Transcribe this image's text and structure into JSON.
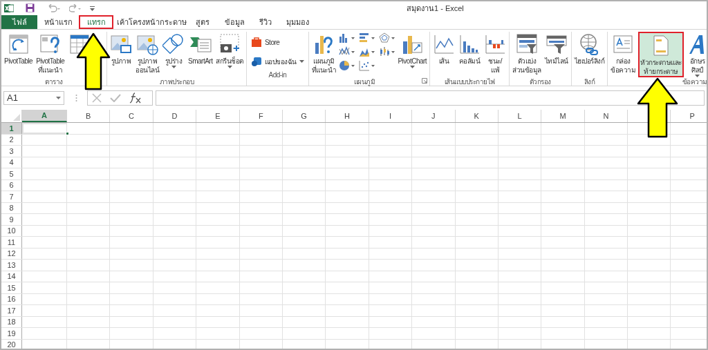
{
  "window": {
    "title": "สมุดงาน1 - Excel"
  },
  "tabs": [
    {
      "label": "ไฟล์",
      "kind": "file",
      "selected": false,
      "highlighted": false
    },
    {
      "label": "หน้าแรก",
      "kind": "tab",
      "selected": false,
      "highlighted": false
    },
    {
      "label": "แทรก",
      "kind": "tab",
      "selected": true,
      "highlighted": true
    },
    {
      "label": "เค้าโครงหน้ากระดาษ",
      "kind": "tab",
      "selected": false,
      "highlighted": false
    },
    {
      "label": "สูตร",
      "kind": "tab",
      "selected": false,
      "highlighted": false
    },
    {
      "label": "ข้อมูล",
      "kind": "tab",
      "selected": false,
      "highlighted": false
    },
    {
      "label": "รีวิว",
      "kind": "tab",
      "selected": false,
      "highlighted": false
    },
    {
      "label": "มุมมอง",
      "kind": "tab",
      "selected": false,
      "highlighted": false
    }
  ],
  "ribbon": {
    "groups": [
      {
        "label": "ตาราง",
        "items": [
          {
            "kind": "large",
            "lines": [
              "PivotTable"
            ]
          },
          {
            "kind": "large",
            "lines": [
              "PivotTable",
              "ที่แนะนำ"
            ]
          },
          {
            "kind": "large"
          }
        ]
      },
      {
        "label": "ภาพประกอบ",
        "items": [
          {
            "kind": "large",
            "lines": [
              "รูปภาพ"
            ]
          },
          {
            "kind": "large",
            "lines": [
              "รูปภาพ",
              "ออนไลน์"
            ]
          },
          {
            "kind": "large",
            "lines": [
              "รูปร่าง"
            ],
            "dropdown": true
          },
          {
            "kind": "large",
            "lines": [
              "SmartArt"
            ]
          },
          {
            "kind": "large",
            "lines": [
              "สกรีนช็อต"
            ],
            "dropdown": true
          }
        ]
      },
      {
        "label": "Add-in",
        "items": [
          {
            "kind": "small",
            "lines": [
              "Store"
            ]
          },
          {
            "kind": "small",
            "lines": [
              "แอปของฉัน"
            ],
            "dropdown": true
          }
        ]
      },
      {
        "label": "แผนภูมิ",
        "launcher": true,
        "items": [
          {
            "kind": "large",
            "lines": [
              "แผนภูมิ",
              "ที่แนะนำ"
            ]
          },
          {
            "kind": "chart-grid"
          },
          {
            "kind": "large",
            "lines": [
              "PivotChart"
            ],
            "dropdown": true
          }
        ]
      },
      {
        "label": "เส้นแบบประกายไฟ",
        "items": [
          {
            "kind": "large",
            "lines": [
              "เส้น"
            ]
          },
          {
            "kind": "large",
            "lines": [
              "คอลัมน์"
            ]
          },
          {
            "kind": "large",
            "lines": [
              "ชนะ/",
              "แพ้"
            ]
          }
        ]
      },
      {
        "label": "ตัวกรอง",
        "items": [
          {
            "kind": "large",
            "lines": [
              "ตัวแบ่ง",
              "ส่วนข้อมูล"
            ]
          },
          {
            "kind": "large",
            "lines": [
              "ไทม์ไลน์"
            ]
          }
        ]
      },
      {
        "label": "ลิงก์",
        "items": [
          {
            "kind": "large",
            "lines": [
              "ไฮเปอร์ลิงก์"
            ]
          }
        ]
      },
      {
        "label": "ข้อความ",
        "items": [
          {
            "kind": "large",
            "lines": [
              "กล่อง",
              "ข้อความ"
            ]
          },
          {
            "kind": "large",
            "lines": [
              "หัวกระดาษและ",
              "ท้ายกระดาษ"
            ],
            "highlighted": true
          },
          {
            "kind": "large",
            "lines": [
              "อักษร",
              "ศิลป์"
            ],
            "dropdown": true
          }
        ]
      }
    ]
  },
  "name_box": {
    "value": "A1"
  },
  "columns": [
    {
      "label": "A",
      "selected": true
    },
    {
      "label": "B",
      "selected": false
    },
    {
      "label": "C",
      "selected": false
    },
    {
      "label": "D",
      "selected": false
    },
    {
      "label": "E",
      "selected": false
    },
    {
      "label": "F",
      "selected": false
    },
    {
      "label": "G",
      "selected": false
    },
    {
      "label": "H",
      "selected": false
    },
    {
      "label": "I",
      "selected": false
    },
    {
      "label": "J",
      "selected": false
    },
    {
      "label": "K",
      "selected": false
    },
    {
      "label": "L",
      "selected": false
    },
    {
      "label": "M",
      "selected": false
    },
    {
      "label": "N",
      "selected": false
    },
    {
      "selected": false
    },
    {
      "label": "P",
      "selected": false
    }
  ],
  "rows": [
    {
      "label": "1",
      "selected": true
    },
    {
      "label": "2",
      "selected": false
    },
    {
      "label": "3",
      "selected": false
    },
    {
      "label": "4",
      "selected": false
    },
    {
      "label": "5",
      "selected": false
    },
    {
      "label": "6",
      "selected": false
    },
    {
      "label": "7",
      "selected": false
    },
    {
      "label": "8",
      "selected": false
    },
    {
      "label": "9",
      "selected": false
    },
    {
      "label": "10",
      "selected": false
    },
    {
      "label": "11",
      "selected": false
    },
    {
      "label": "12",
      "selected": false
    },
    {
      "label": "13",
      "selected": false
    },
    {
      "label": "14",
      "selected": false
    },
    {
      "label": "15",
      "selected": false
    },
    {
      "label": "16",
      "selected": false
    },
    {
      "label": "17",
      "selected": false
    },
    {
      "label": "18",
      "selected": false
    },
    {
      "label": "19",
      "selected": false
    },
    {
      "label": "20",
      "selected": false
    }
  ]
}
